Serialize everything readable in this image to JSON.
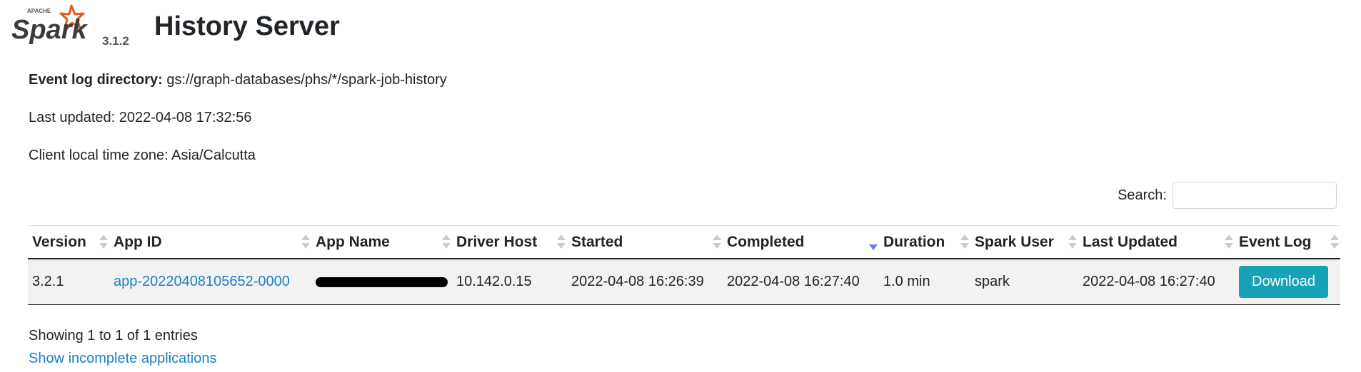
{
  "header": {
    "logo_brand": "Spark",
    "logo_superscript": "APACHE",
    "spark_version": "3.1.2",
    "title": "History Server"
  },
  "info": {
    "event_log_label": "Event log directory:",
    "event_log_value": "gs://graph-databases/phs/*/spark-job-history",
    "last_updated": "Last updated: 2022-04-08 17:32:56",
    "timezone": "Client local time zone: Asia/Calcutta"
  },
  "search": {
    "label": "Search:",
    "value": ""
  },
  "table": {
    "columns": [
      "Version",
      "App ID",
      "App Name",
      "Driver Host",
      "Started",
      "Completed",
      "Duration",
      "Spark User",
      "Last Updated",
      "Event Log"
    ],
    "sorted_column": "Completed",
    "rows": [
      {
        "version": "3.2.1",
        "app_id": "app-20220408105652-0000",
        "app_name": "[redacted]",
        "driver_host": "10.142.0.15",
        "started": "2022-04-08 16:26:39",
        "completed": "2022-04-08 16:27:40",
        "duration": "1.0 min",
        "spark_user": "spark",
        "last_updated": "2022-04-08 16:27:40",
        "event_log": "Download"
      }
    ]
  },
  "footer": {
    "entries_info": "Showing 1 to 1 of 1 entries",
    "incomplete_link": "Show incomplete applications"
  },
  "colors": {
    "link": "#1a82c3",
    "download_button": "#17a2b8",
    "logo_star": "#e25a1c",
    "sort_active": "#6c7ed9"
  }
}
